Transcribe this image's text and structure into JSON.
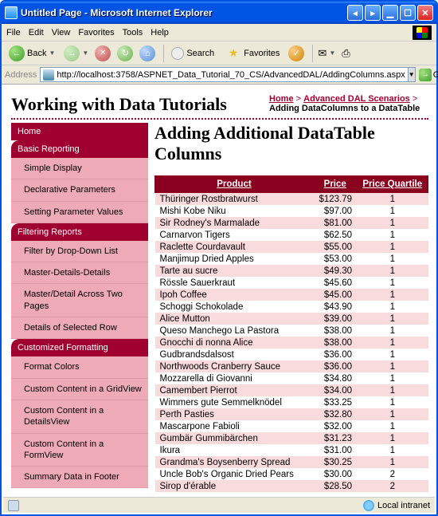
{
  "window": {
    "title": "Untitled Page - Microsoft Internet Explorer"
  },
  "menubar": {
    "file": "File",
    "edit": "Edit",
    "view": "View",
    "favorites": "Favorites",
    "tools": "Tools",
    "help": "Help"
  },
  "toolbar": {
    "back": "Back",
    "search": "Search",
    "favorites": "Favorites"
  },
  "address": {
    "label": "Address",
    "url": "http://localhost:3758/ASPNET_Data_Tutorial_70_CS/AdvancedDAL/AddingColumns.aspx",
    "go": "Go"
  },
  "page": {
    "site_title": "Working with Data Tutorials",
    "breadcrumb": {
      "home": "Home",
      "section": "Advanced DAL Scenarios",
      "sep": ">",
      "current": "Adding DataColumns to a DataTable"
    },
    "heading": "Adding Additional DataTable Columns"
  },
  "sidebar": {
    "home": "Home",
    "g1": "Basic Reporting",
    "g1_items": [
      "Simple Display",
      "Declarative Parameters",
      "Setting Parameter Values"
    ],
    "g2": "Filtering Reports",
    "g2_items": [
      "Filter by Drop-Down List",
      "Master-Details-Details",
      "Master/Detail Across Two Pages",
      "Details of Selected Row"
    ],
    "g3": "Customized Formatting",
    "g3_items": [
      "Format Colors",
      "Custom Content in a GridView",
      "Custom Content in a DetailsView",
      "Custom Content in a FormView",
      "Summary Data in Footer"
    ]
  },
  "table": {
    "headers": {
      "product": "Product",
      "price": "Price",
      "quartile": "Price Quartile"
    },
    "rows": [
      {
        "p": "Thüringer Rostbratwurst",
        "price": "$123.79",
        "q": "1"
      },
      {
        "p": "Mishi Kobe Niku",
        "price": "$97.00",
        "q": "1"
      },
      {
        "p": "Sir Rodney's Marmalade",
        "price": "$81.00",
        "q": "1"
      },
      {
        "p": "Carnarvon Tigers",
        "price": "$62.50",
        "q": "1"
      },
      {
        "p": "Raclette Courdavault",
        "price": "$55.00",
        "q": "1"
      },
      {
        "p": "Manjimup Dried Apples",
        "price": "$53.00",
        "q": "1"
      },
      {
        "p": "Tarte au sucre",
        "price": "$49.30",
        "q": "1"
      },
      {
        "p": "Rössle Sauerkraut",
        "price": "$45.60",
        "q": "1"
      },
      {
        "p": "Ipoh Coffee",
        "price": "$45.00",
        "q": "1"
      },
      {
        "p": "Schoggi Schokolade",
        "price": "$43.90",
        "q": "1"
      },
      {
        "p": "Alice Mutton",
        "price": "$39.00",
        "q": "1"
      },
      {
        "p": "Queso Manchego La Pastora",
        "price": "$38.00",
        "q": "1"
      },
      {
        "p": "Gnocchi di nonna Alice",
        "price": "$38.00",
        "q": "1"
      },
      {
        "p": "Gudbrandsdalsost",
        "price": "$36.00",
        "q": "1"
      },
      {
        "p": "Northwoods Cranberry Sauce",
        "price": "$36.00",
        "q": "1"
      },
      {
        "p": "Mozzarella di Giovanni",
        "price": "$34.80",
        "q": "1"
      },
      {
        "p": "Camembert Pierrot",
        "price": "$34.00",
        "q": "1"
      },
      {
        "p": "Wimmers gute Semmelknödel",
        "price": "$33.25",
        "q": "1"
      },
      {
        "p": "Perth Pasties",
        "price": "$32.80",
        "q": "1"
      },
      {
        "p": "Mascarpone Fabioli",
        "price": "$32.00",
        "q": "1"
      },
      {
        "p": "Gumbär Gummibärchen",
        "price": "$31.23",
        "q": "1"
      },
      {
        "p": "Ikura",
        "price": "$31.00",
        "q": "1"
      },
      {
        "p": "Grandma's Boysenberry Spread",
        "price": "$30.25",
        "q": "1"
      },
      {
        "p": "Uncle Bob's Organic Dried Pears",
        "price": "$30.00",
        "q": "2"
      },
      {
        "p": "Sirop d'érable",
        "price": "$28.50",
        "q": "2"
      }
    ]
  },
  "status": {
    "zone": "Local intranet"
  }
}
